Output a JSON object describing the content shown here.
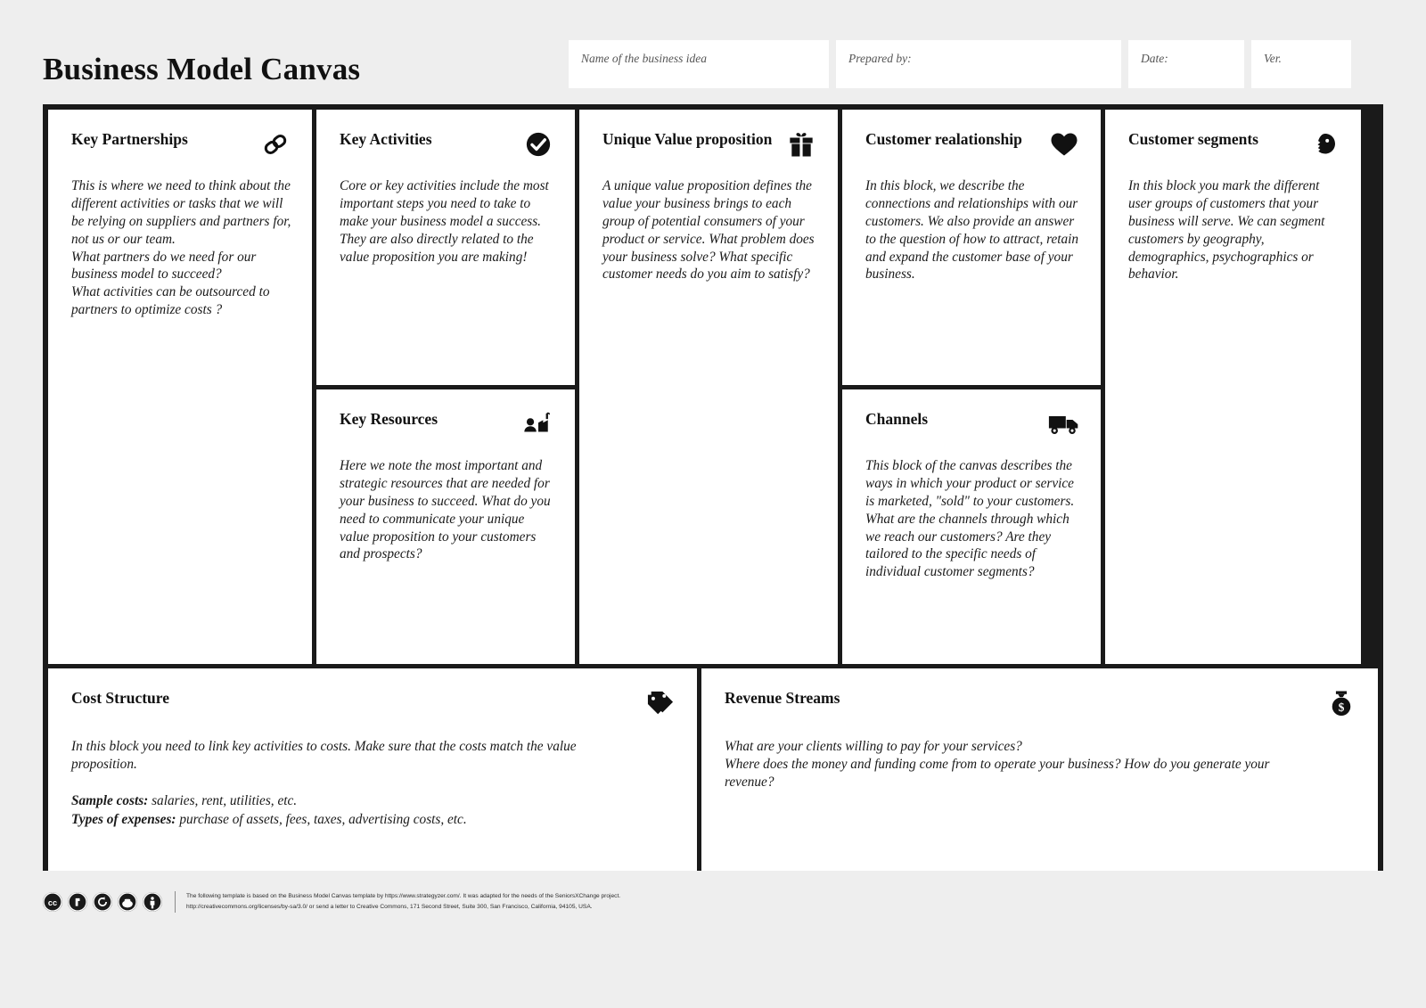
{
  "header": {
    "title": "Business Model Canvas",
    "fields": [
      {
        "name": "business-idea-name",
        "placeholder": "Name of the business idea",
        "value": ""
      },
      {
        "name": "prepared-by",
        "placeholder": "Prepared by:",
        "value": ""
      },
      {
        "name": "date",
        "placeholder": "Date:",
        "value": ""
      },
      {
        "name": "version",
        "placeholder": "Ver.",
        "value": ""
      }
    ]
  },
  "blocks": {
    "key_partnerships": {
      "title": "Key Partnerships",
      "icon": "chain-link-icon",
      "body": "This is where we need to think about the different activities or tasks that we will be relying on suppliers and partners for, not us or our team.\nWhat partners do we need for our business model to succeed?\nWhat activities can be outsourced to partners to optimize costs ?"
    },
    "key_activities": {
      "title": "Key Activities",
      "icon": "check-circle-icon",
      "body": "Core or key activities include the most important steps you need to take to make your business model a success. They are also directly related to the value proposition you are making!"
    },
    "key_resources": {
      "title": "Key Resources",
      "icon": "factory-worker-icon",
      "body": "Here we note the most important and strategic resources that are needed for your business to succeed. What do you need to communicate your unique value proposition to your customers and prospects?"
    },
    "unique_value_proposition": {
      "title": "Unique Value proposition",
      "icon": "gift-icon",
      "body": "A unique value proposition defines the value your business brings to each group of potential consumers of your product or service. What problem does your business solve? What specific customer needs do you aim to satisfy?"
    },
    "customer_relationship": {
      "title": "Customer realationship",
      "icon": "heart-icon",
      "body": "In this block, we describe the connections and relationships with our customers. We also provide an answer to the question of how to attract, retain and expand the customer base of your business."
    },
    "channels": {
      "title": "Channels",
      "icon": "delivery-truck-icon",
      "body": "This block of the canvas describes the ways in which your product or service is marketed, \"sold\" to your customers. What are the channels through which we reach our customers? Are they tailored to the specific needs of individual customer segments?"
    },
    "customer_segments": {
      "title": "Customer segments",
      "icon": "person-profile-icon",
      "body": "In this block you mark the different user groups of customers that your business will serve. We can segment customers by geography, demographics, psychographics or behavior."
    },
    "cost_structure": {
      "title": "Cost Structure",
      "icon": "price-tag-icon",
      "body": "In this block you need to link key activities to costs. Make sure that the costs match the value proposition.",
      "sample_costs_label": "Sample costs:",
      "sample_costs_value": " salaries, rent, utilities, etc.",
      "types_expenses_label": "Types of expenses:",
      "types_expenses_value": " purchase of assets, fees, taxes, advertising costs, etc."
    },
    "revenue_streams": {
      "title": "Revenue Streams",
      "icon": "money-bag-icon",
      "body": "What are your clients willing to pay for your services?\nWhere does the money and funding come from to operate your business? How do you generate your revenue?"
    }
  },
  "footer": {
    "badges": [
      "cc-logo-icon",
      "cc-copyleft-icon",
      "cc-share-alike-icon",
      "cc-noncommercial-icon",
      "cc-attribution-icon"
    ],
    "line1": "The following template is based on the Business Model Canvas template by https://www.strategyzer.com/. It was adapted for the needs of the SeniorsXChange project.",
    "line2": "http://creativecommons.org/licenses/by-sa/3.0/ or send a letter to Creative Commons, 171 Second Street, Suite 300, San Francisco, California, 94105, USA."
  },
  "colors": {
    "background": "#eeeeee",
    "frame": "#1a1a1a",
    "cell": "#ffffff",
    "text": "#1a1a1a"
  }
}
